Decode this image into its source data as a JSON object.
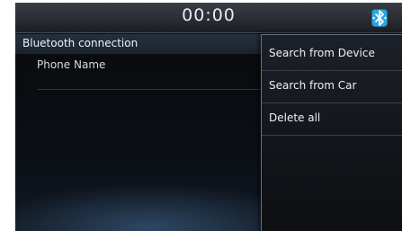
{
  "status_bar": {
    "clock": "00:00",
    "bluetooth_icon": "bluetooth-icon",
    "bluetooth_color": "#2aa7e0"
  },
  "list": {
    "title": "Bluetooth connection",
    "items": [
      {
        "label": "Phone Name"
      }
    ]
  },
  "popup_menu": {
    "items": [
      {
        "label": "Search from Device"
      },
      {
        "label": "Search from Car"
      },
      {
        "label": "Delete all"
      }
    ]
  }
}
